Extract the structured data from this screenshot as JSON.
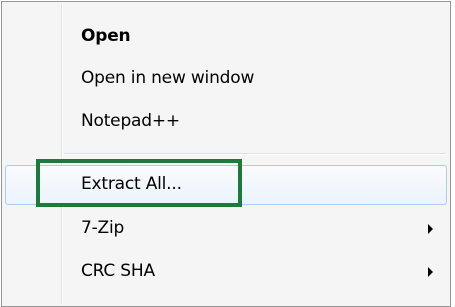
{
  "context_menu": {
    "items": [
      {
        "label": "Open",
        "bold": true
      },
      {
        "label": "Open in new window"
      },
      {
        "label": "Notepad++"
      },
      {
        "label": "Extract All...",
        "hovered": true,
        "annotated": true
      },
      {
        "label": "7-Zip",
        "has_submenu": true
      },
      {
        "label": "CRC SHA",
        "has_submenu": true
      }
    ]
  },
  "colors": {
    "menu_background": "#f5f5f5",
    "hover_border": "#aeccf1",
    "annotation_box": "#1e7a3c"
  }
}
